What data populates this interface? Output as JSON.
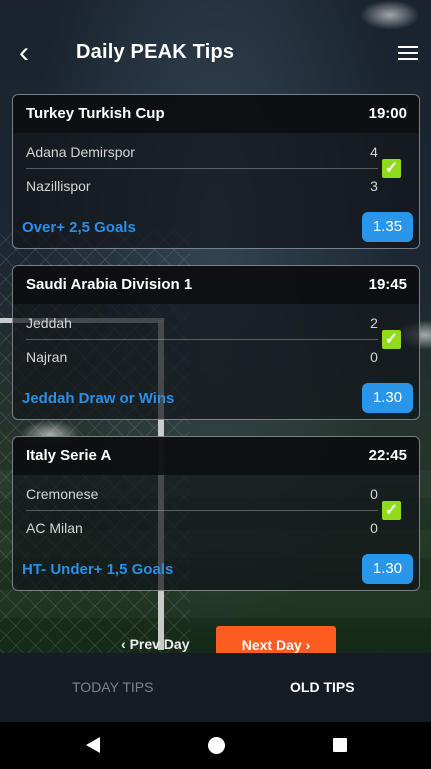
{
  "header": {
    "title": "Daily PEAK Tips",
    "back_icon": "‹"
  },
  "matches": [
    {
      "league": "Turkey Turkish Cup",
      "time": "19:00",
      "home": "Adana Demirspor",
      "home_score": "4",
      "away": "Nazillispor",
      "away_score": "3",
      "tip": "Over+ 2,5 Goals",
      "odds": "1.35",
      "won": true
    },
    {
      "league": "Saudi Arabia Division 1",
      "time": "19:45",
      "home": "Jeddah",
      "home_score": "2",
      "away": "Najran",
      "away_score": "0",
      "tip": "Jeddah Draw or Wins",
      "odds": "1.30",
      "won": true
    },
    {
      "league": "Italy Serie A",
      "time": "22:45",
      "home": "Cremonese",
      "home_score": "0",
      "away": "AC Milan",
      "away_score": "0",
      "tip": "HT- Under+ 1,5 Goals",
      "odds": "1.30",
      "won": true
    }
  ],
  "pager": {
    "prev_label": "Prev Day",
    "next_label": "Next Day",
    "prev_icon": "‹",
    "next_icon": "›"
  },
  "tabs": {
    "today": "TODAY TIPS",
    "old": "OLD TIPS",
    "selected": "OLD TIPS"
  },
  "colors": {
    "accent_blue": "#2996ea",
    "tip_text": "#2b8ee8",
    "check_green": "#8edc1a",
    "next_orange": "#fe5d21"
  },
  "icons": {
    "check": "✓"
  }
}
